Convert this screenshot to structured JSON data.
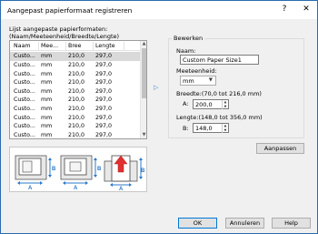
{
  "window": {
    "title": "Aangepast papierformaat registreren",
    "help_glyph": "?",
    "close_glyph": "✕"
  },
  "list": {
    "caption_line1": "Lijst aangepaste papierformaten:",
    "caption_line2": "(Naam/Meeteenheid/Breedte/Lengte)",
    "headers": [
      "Naam",
      "Mee...",
      "Bree",
      "Lengte"
    ],
    "rows": [
      [
        "Custo...",
        "mm",
        "210,0",
        "297,0"
      ],
      [
        "Custo...",
        "mm",
        "210,0",
        "297,0"
      ],
      [
        "Custo...",
        "mm",
        "210,0",
        "297,0"
      ],
      [
        "Custo...",
        "mm",
        "210,0",
        "297,0"
      ],
      [
        "Custo...",
        "mm",
        "210,0",
        "297,0"
      ],
      [
        "Custo...",
        "mm",
        "210,0",
        "297,0"
      ],
      [
        "Custo...",
        "mm",
        "210,0",
        "297,0"
      ],
      [
        "Custo...",
        "mm",
        "210,0",
        "297,0"
      ],
      [
        "Custo...",
        "mm",
        "210,0",
        "297,0"
      ],
      [
        "Custo...",
        "mm",
        "210,0",
        "297,0"
      ]
    ],
    "selected_row": 0
  },
  "edit": {
    "group_title": "Bewerken",
    "name_label": "Naam:",
    "name_value": "Custom Paper Size1",
    "unit_label": "Meeteenheid:",
    "unit_value": "mm",
    "width_label": "Breedte:(70,0 tot 216,0 mm)",
    "width_prefix": "A:",
    "width_value": "200,0",
    "length_label": "Lengte:(148,0 tot 356,0 mm)",
    "length_prefix": "B:",
    "length_value": "148,0"
  },
  "diagram_labels": {
    "a": "A",
    "b": "B"
  },
  "buttons": {
    "adjust": "Aanpassen",
    "ok": "OK",
    "cancel": "Annuleren",
    "help": "Help"
  },
  "colors": {
    "accent_blue": "#2b78c8",
    "arrow_red": "#e03030",
    "selection": "#d9d9d9"
  }
}
